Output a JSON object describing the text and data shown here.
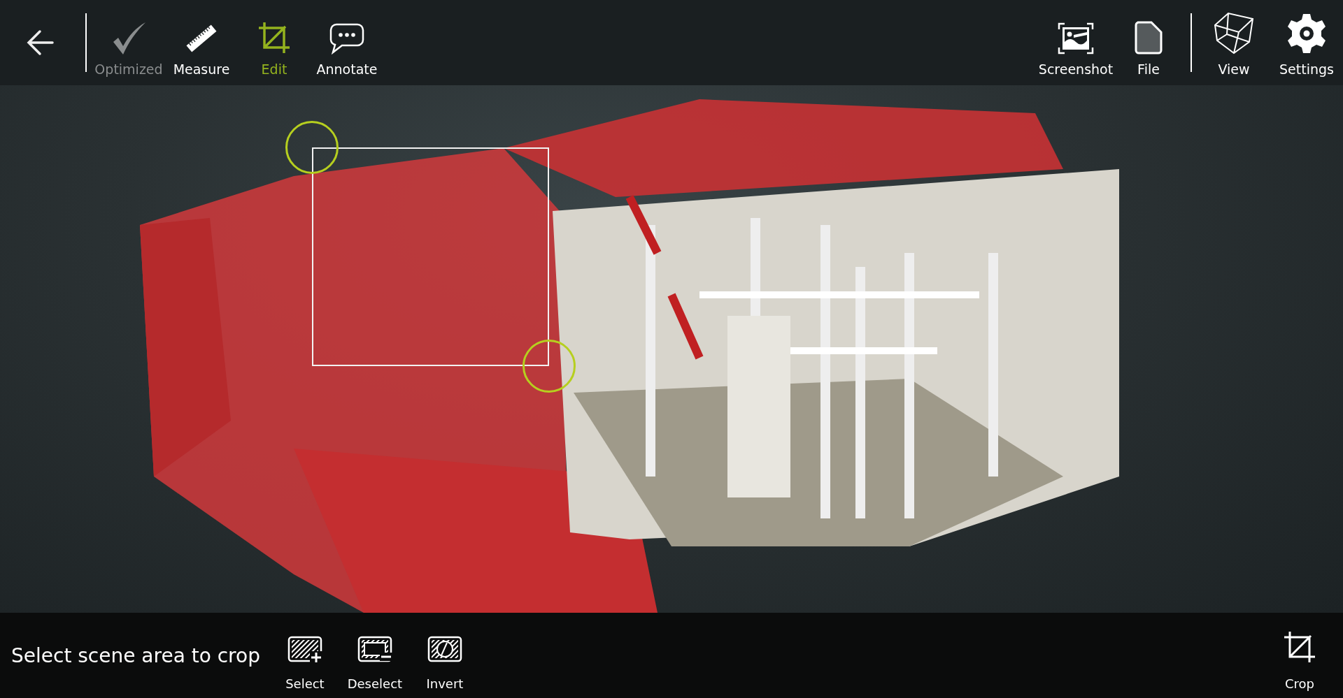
{
  "top_bar": {
    "left_tools": [
      {
        "kind": "optimized",
        "label": "Optimized",
        "disabled": true,
        "selected": false
      },
      {
        "kind": "measure",
        "label": "Measure",
        "disabled": false,
        "selected": false
      },
      {
        "kind": "edit",
        "label": "Edit",
        "disabled": false,
        "selected": true
      },
      {
        "kind": "annotate",
        "label": "Annotate",
        "disabled": false,
        "selected": false
      }
    ],
    "right_tools": [
      {
        "kind": "screenshot",
        "label": "Screenshot"
      },
      {
        "kind": "file",
        "label": "File"
      },
      {
        "kind": "separator"
      },
      {
        "kind": "view",
        "label": "View"
      },
      {
        "kind": "settings",
        "label": "Settings"
      }
    ]
  },
  "bottom_bar": {
    "hint": "Select scene area to crop",
    "actions": [
      {
        "kind": "select",
        "label": "Select"
      },
      {
        "kind": "deselect",
        "label": "Deselect"
      },
      {
        "kind": "invert",
        "label": "Invert"
      }
    ],
    "crop": {
      "label": "Crop"
    }
  }
}
